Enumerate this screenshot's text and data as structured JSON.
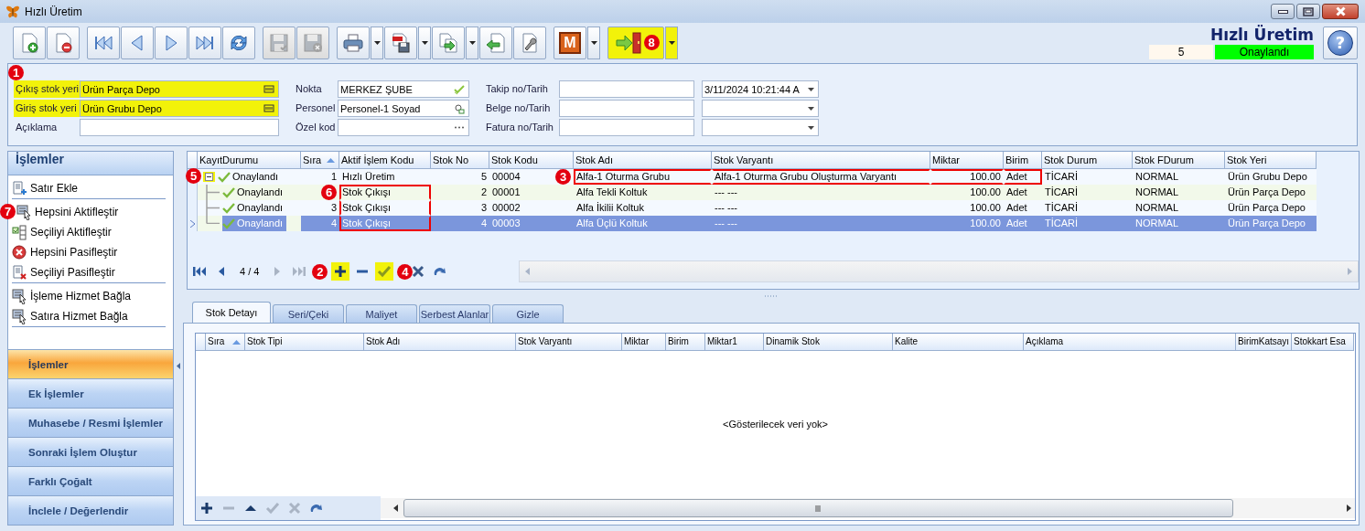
{
  "window": {
    "title": "Hızlı Üretim"
  },
  "toolbar": {
    "groups": [
      [
        {
          "disabled": false
        },
        {
          "disabled": false
        }
      ],
      [
        {
          "disabled": false
        },
        {
          "disabled": false
        },
        {
          "disabled": false
        },
        {
          "disabled": false
        },
        {
          "disabled": false
        }
      ],
      [
        {
          "disabled": true
        },
        {
          "disabled": true
        }
      ],
      [
        {
          "disabled": false,
          "dropdown": true
        },
        {
          "disabled": false,
          "dropdown": true
        },
        {
          "disabled": false,
          "dropdown": true
        },
        {
          "disabled": false
        },
        {
          "disabled": false
        }
      ],
      [
        {
          "disabled": false,
          "dropdown": true,
          "label": "M"
        }
      ],
      [
        {
          "disabled": false,
          "dropdown": true,
          "highlighted": true,
          "marker": "8"
        }
      ]
    ]
  },
  "header": {
    "title": "Hızlı Üretim",
    "number": "5",
    "status": "Onaylandı",
    "help": "?"
  },
  "form": {
    "marker": "1",
    "columns": [
      [
        {
          "label": "Çıkış stok yeri",
          "kind": "lookup",
          "value": "Ürün Parça Depo",
          "highlighted": true
        },
        {
          "label": "Giriş stok yeri",
          "kind": "lookup",
          "value": "Ürün Grubu Depo",
          "highlighted": true
        },
        {
          "label": "Açıklama",
          "kind": "text",
          "highlighted": false
        }
      ],
      [
        {
          "label": "Nokta",
          "kind": "check",
          "value": "MERKEZ ŞUBE",
          "highlighted": false
        },
        {
          "label": "Personel",
          "kind": "person",
          "value": "Personel-1 Soyad",
          "highlighted": false
        },
        {
          "label": "Özel kod",
          "kind": "ellipsis",
          "highlighted": false
        }
      ],
      [
        {
          "label": "Takip no/Tarih",
          "kind": "text",
          "highlighted": false,
          "date": "3/11/2024 10:21:44 A"
        },
        {
          "label": "Belge no/Tarih",
          "kind": "text",
          "highlighted": false
        },
        {
          "label": "Fatura no/Tarih",
          "kind": "text",
          "highlighted": false
        }
      ]
    ]
  },
  "sidebar": {
    "title": "İşlemler",
    "items": [
      {
        "label": "Satır Ekle",
        "kind": "add",
        "separator_after": true
      },
      {
        "label": "Hepsini Aktifleştir",
        "kind": "cursor",
        "separator_after": false,
        "marker": "7"
      },
      {
        "label": "Seçiliyi Aktifleştir",
        "kind": "checklist",
        "separator_after": false
      },
      {
        "label": "Hepsini Pasifleştir",
        "kind": "error",
        "separator_after": false
      },
      {
        "label": "Seçiliyi Pasifleştir",
        "kind": "remove",
        "separator_after": true
      },
      {
        "label": "İşleme Hizmet Bağla",
        "kind": "cursor",
        "separator_after": false
      },
      {
        "label": "Satıra Hizmet Bağla",
        "kind": "cursor",
        "separator_after": true
      }
    ],
    "sections": [
      {
        "label": "İşlemler",
        "selected": true
      },
      {
        "label": "Ek İşlemler",
        "selected": false
      },
      {
        "label": "Muhasebe / Resmi İşlemler",
        "selected": false
      },
      {
        "label": "Sonraki İşlem Oluştur",
        "selected": false
      },
      {
        "label": "Farklı Çoğalt",
        "selected": false
      },
      {
        "label": "İnclele / Değerlendir",
        "selected": false
      }
    ]
  },
  "grid": {
    "columns": [
      {
        "label": "KayıtDurumu",
        "sorted": false
      },
      {
        "label": "Sıra",
        "sorted": true
      },
      {
        "label": "Aktif İşlem Kodu",
        "sorted": false
      },
      {
        "label": "Stok No",
        "sorted": false
      },
      {
        "label": "Stok Kodu",
        "sorted": false
      },
      {
        "label": "Stok Adı",
        "sorted": false
      },
      {
        "label": "Stok Varyantı",
        "sorted": false
      },
      {
        "label": "Miktar",
        "sorted": false
      },
      {
        "label": "Birim",
        "sorted": false
      },
      {
        "label": "Stok Durum",
        "sorted": false
      },
      {
        "label": "Stok FDurum",
        "sorted": false
      },
      {
        "label": "Stok Yeri",
        "sorted": false
      }
    ],
    "rows": [
      {
        "selected": false,
        "expanded": true,
        "expander_highlighted": true,
        "expander_marker": "5",
        "cells": [
          {
            "text": "Onaylandı",
            "outlined": false
          },
          {
            "text": "1",
            "outlined": false
          },
          {
            "text": "Hızlı Üretim",
            "outlined": false
          },
          {
            "text": "5",
            "outlined": false
          },
          {
            "text": "00004",
            "outlined": false
          },
          {
            "text": "Alfa-1 Oturma Grubu",
            "outlined": true,
            "marker": "3"
          },
          {
            "text": "Alfa-1 Oturma Grubu Oluşturma Varyantı",
            "outlined": true
          },
          {
            "text": "100.00",
            "outlined": true
          },
          {
            "text": "Adet",
            "outlined": true
          },
          {
            "text": "TİCARİ",
            "outlined": false
          },
          {
            "text": "NORMAL",
            "outlined": false
          },
          {
            "text": "Ürün Grubu Depo",
            "outlined": false
          }
        ],
        "children": [
          {
            "selected": false,
            "cells": [
              {
                "text": "Onaylandı",
                "outlined": false
              },
              {
                "outlined": false
              },
              {
                "text": "Stok Çıkışı",
                "outlined": true,
                "marker": "6"
              },
              {
                "text": "2",
                "outlined": false
              },
              {
                "text": "00001",
                "outlined": false
              },
              {
                "text": "Alfa Tekli Koltuk",
                "outlined": false
              },
              {
                "text": "--- ---",
                "outlined": false
              },
              {
                "text": "100.00",
                "outlined": false
              },
              {
                "text": "Adet",
                "outlined": false
              },
              {
                "text": "TİCARİ",
                "outlined": false
              },
              {
                "text": "NORMAL",
                "outlined": false
              },
              {
                "text": "Ürün Parça Depo",
                "outlined": false
              }
            ]
          },
          {
            "selected": false,
            "cells": [
              {
                "text": "Onaylandı",
                "outlined": false
              },
              {
                "text": "3",
                "outlined": false
              },
              {
                "text": "Stok Çıkışı",
                "outlined": true
              },
              {
                "text": "3",
                "outlined": false
              },
              {
                "text": "00002",
                "outlined": false
              },
              {
                "text": "Alfa İkilii Koltuk",
                "outlined": false
              },
              {
                "text": "--- ---",
                "outlined": false
              },
              {
                "text": "100.00",
                "outlined": false
              },
              {
                "text": "Adet",
                "outlined": false
              },
              {
                "text": "TİCARİ",
                "outlined": false
              },
              {
                "text": "NORMAL",
                "outlined": false
              },
              {
                "text": "Ürün Parça Depo",
                "outlined": false
              }
            ]
          },
          {
            "selected": true,
            "cells": [
              {
                "text": "Onaylandı",
                "outlined": false
              },
              {
                "text": "4",
                "outlined": false
              },
              {
                "text": "Stok Çıkışı",
                "outlined": true
              },
              {
                "text": "4",
                "outlined": false
              },
              {
                "text": "00003",
                "outlined": false
              },
              {
                "text": "Alfa Üçlü Koltuk",
                "outlined": false
              },
              {
                "text": "--- ---",
                "outlined": false
              },
              {
                "text": "100.00",
                "outlined": false
              },
              {
                "text": "Adet",
                "outlined": false
              },
              {
                "text": "TİCARİ",
                "outlined": false
              },
              {
                "text": "NORMAL",
                "outlined": false
              },
              {
                "text": "Ürün Parça Depo",
                "outlined": false
              }
            ]
          }
        ]
      }
    ],
    "nav": {
      "position": "4 / 4",
      "buttons": [
        {
          "kind": "first",
          "disabled": false
        },
        {
          "kind": "prev",
          "disabled": false
        },
        {
          "kind": "next",
          "disabled": true
        },
        {
          "kind": "last",
          "disabled": true
        },
        {
          "kind": "add",
          "disabled": false,
          "highlighted": true,
          "marker": "2"
        },
        {
          "kind": "remove",
          "disabled": false,
          "highlighted": false
        },
        {
          "kind": "check",
          "disabled": false,
          "highlighted": true
        },
        {
          "kind": "cancel",
          "disabled": false,
          "highlighted": false,
          "marker": "4"
        },
        {
          "kind": "redo",
          "disabled": false,
          "highlighted": false
        }
      ]
    }
  },
  "tabs": [
    {
      "label": "Stok Detayı",
      "selected": true
    },
    {
      "label": "Seri/Çeki",
      "selected": false
    },
    {
      "label": "Maliyet",
      "selected": false
    },
    {
      "label": "Serbest Alanlar",
      "selected": false
    },
    {
      "label": "Gizle",
      "selected": false
    }
  ],
  "detail_grid": {
    "columns": [
      {
        "label": "Sıra",
        "sorted": true
      },
      {
        "label": "Stok Tipi",
        "sorted": false
      },
      {
        "label": "Stok Adı",
        "sorted": false
      },
      {
        "label": "Stok Varyantı",
        "sorted": false
      },
      {
        "label": "Miktar",
        "sorted": false
      },
      {
        "label": "Birim",
        "sorted": false
      },
      {
        "label": "Miktar1",
        "sorted": false
      },
      {
        "label": "Dinamik Stok",
        "sorted": false
      },
      {
        "label": "Kalite",
        "sorted": false
      },
      {
        "label": "Açıklama",
        "sorted": false
      },
      {
        "label": "BirimKatsayı",
        "sorted": false
      },
      {
        "label": "Stokkart Esa",
        "sorted": false
      }
    ],
    "empty_text": "<Gösterilecek veri yok>",
    "nav": [
      {
        "kind": "add",
        "disabled": false
      },
      {
        "kind": "remove",
        "disabled": true
      },
      {
        "kind": "up",
        "disabled": false
      },
      {
        "kind": "check",
        "disabled": true
      },
      {
        "kind": "cancel",
        "disabled": true
      },
      {
        "kind": "redo",
        "disabled": false
      }
    ]
  }
}
